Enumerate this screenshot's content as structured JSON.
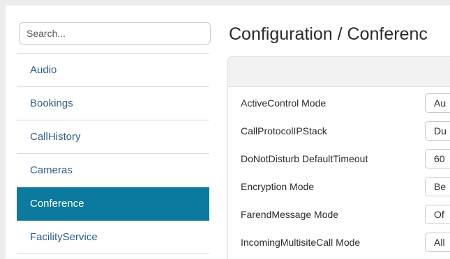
{
  "sidebar": {
    "search_placeholder": "Search...",
    "items": [
      {
        "label": "Audio"
      },
      {
        "label": "Bookings"
      },
      {
        "label": "CallHistory"
      },
      {
        "label": "Cameras"
      },
      {
        "label": "Conference",
        "active": true
      },
      {
        "label": "FacilityService"
      }
    ]
  },
  "main": {
    "title": "Configuration / Conferenc",
    "settings": [
      {
        "label": "ActiveControl Mode",
        "value": "Au"
      },
      {
        "label": "CallProtocolIPStack",
        "value": "Du"
      },
      {
        "label": "DoNotDisturb DefaultTimeout",
        "value": "60"
      },
      {
        "label": "Encryption Mode",
        "value": "Be"
      },
      {
        "label": "FarendMessage Mode",
        "value": "Of"
      },
      {
        "label": "IncomingMultisiteCall Mode",
        "value": "All"
      }
    ]
  },
  "colors": {
    "accent": "#0b7a9e",
    "link": "#2d5e8c"
  }
}
